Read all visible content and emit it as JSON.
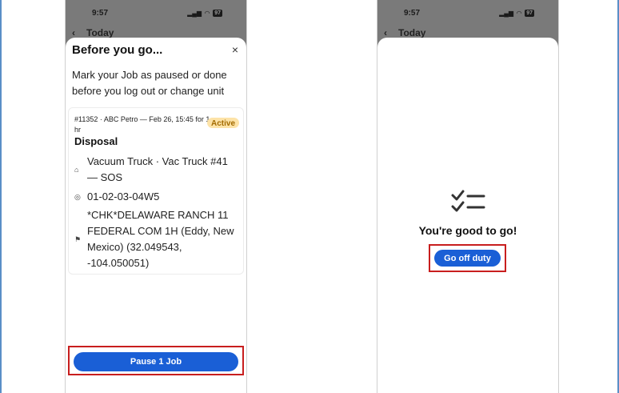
{
  "left_screen": {
    "status_bar": {
      "time": "9:57",
      "battery": "97"
    },
    "background_header": {
      "title": "Today"
    },
    "sheet": {
      "title": "Before you go...",
      "close_glyph": "×",
      "subtitle": "Mark your Job as paused or done before you log out or change unit",
      "job": {
        "meta": "#11352 · ABC Petro — Feb 26, 15:45 for 1 hr",
        "status_badge": "Active",
        "type": "Disposal",
        "vehicle": "Vacuum Truck · Vac Truck #41 — SOS",
        "location_code": "01-02-03-04W5",
        "site": "*CHK*DELAWARE RANCH 11 FEDERAL COM 1H (Eddy, New Mexico) (32.049543, -104.050051)"
      },
      "primary_button": "Pause 1 Job"
    }
  },
  "right_screen": {
    "status_bar": {
      "time": "9:57",
      "battery": "97"
    },
    "background_header": {
      "title": "Today"
    },
    "message": "You're good to go!",
    "primary_button": "Go off duty",
    "icon": "checklist-icon"
  },
  "colors": {
    "primary_blue": "#1a5fd6",
    "highlight_red": "#c81e1e",
    "badge_bg": "#fde3a8",
    "badge_text": "#a36b00",
    "overlay_gray": "#7a7a7a"
  }
}
